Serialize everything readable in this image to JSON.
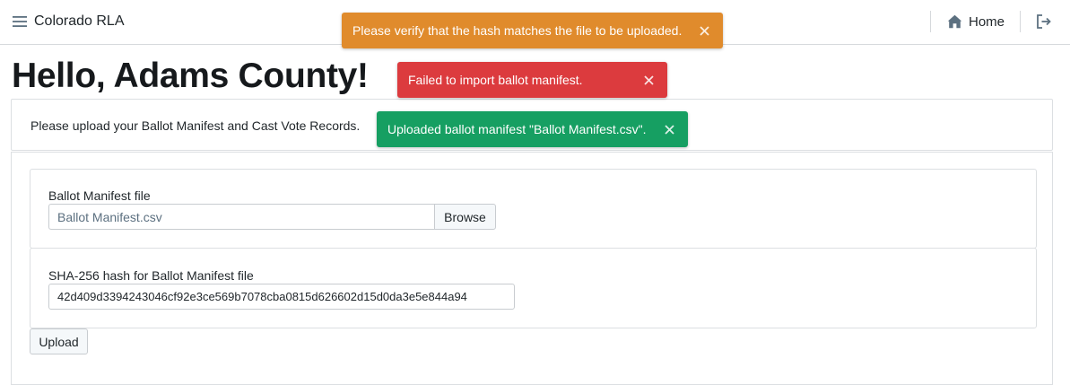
{
  "navbar": {
    "brand": "Colorado RLA",
    "home_label": "Home",
    "icons": {
      "menu": "hamburger-menu-icon",
      "home": "home-icon",
      "logout": "logout-icon"
    }
  },
  "page": {
    "title": "Hello, Adams County!",
    "intro": "Please upload your Ballot Manifest and Cast Vote Records."
  },
  "form": {
    "manifest": {
      "label": "Ballot Manifest file",
      "file_name": "Ballot Manifest.csv",
      "browse_label": "Browse"
    },
    "hash": {
      "label": "SHA-256 hash for Ballot Manifest file",
      "value": "42d409d3394243046cf92e3ce569b7078cba0815d626602d15d0da3e5e844a94"
    },
    "upload_label": "Upload"
  },
  "toasts": {
    "warning": {
      "message": "Please verify that the hash matches the file to be uploaded.",
      "color": "#e08b2c"
    },
    "danger": {
      "message": "Failed to import ballot manifest.",
      "color": "#dc3b3e"
    },
    "success": {
      "message": "Uploaded ballot manifest \"Ballot Manifest.csv\".",
      "color": "#169f62"
    }
  }
}
